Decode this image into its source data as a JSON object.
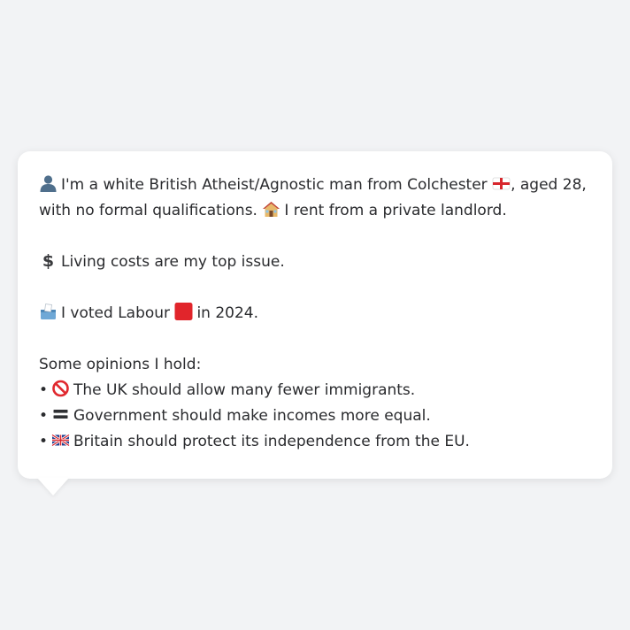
{
  "profile": {
    "intro_line1_a": "I'm a white British Atheist/Agnostic man from Colchester",
    "intro_line1_b": ", aged 28,",
    "intro_line2_a": "with no formal qualifications.",
    "intro_line2_b": "I rent from a private landlord.",
    "top_issue": "Living costs are my top issue.",
    "vote_a": "I voted Labour",
    "vote_b": "in 2024.",
    "opinions_header": "Some opinions I hold:",
    "opinions": [
      {
        "icon": "prohibited-icon",
        "text": "The UK should allow many fewer immigrants."
      },
      {
        "icon": "equals-icon",
        "text": "Government should make incomes more equal."
      },
      {
        "icon": "uk-flag-icon",
        "text": "Britain should protect its independence from the EU."
      }
    ],
    "bullet": "•"
  },
  "colors": {
    "background": "#f2f3f5",
    "card": "#ffffff",
    "text": "#2a2b2e",
    "labour_red": "#e1252b",
    "england_red": "#d7262c"
  }
}
